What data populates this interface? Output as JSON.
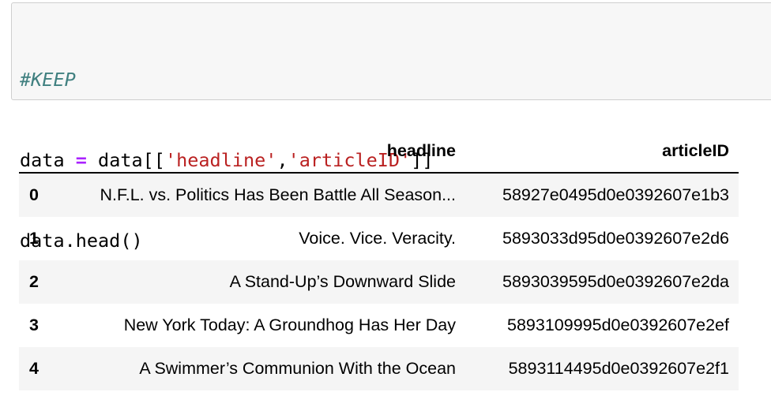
{
  "code_cell": {
    "comment": "#KEEP",
    "line2": {
      "var": "data ",
      "op": "=",
      "mid": " data[[",
      "str1": "'headline'",
      "comma": ",",
      "str2": "'articleID'",
      "end": "]]"
    },
    "line3": "data.head()"
  },
  "dataframe": {
    "columns": [
      "",
      "headline",
      "articleID"
    ],
    "rows": [
      {
        "index": "0",
        "headline": "N.F.L. vs. Politics Has Been Battle All Season...",
        "articleID": "58927e0495d0e0392607e1b3"
      },
      {
        "index": "1",
        "headline": "Voice. Vice. Veracity.",
        "articleID": "5893033d95d0e0392607e2d6"
      },
      {
        "index": "2",
        "headline": "A Stand-Up’s Downward Slide",
        "articleID": "5893039595d0e0392607e2da"
      },
      {
        "index": "3",
        "headline": "New York Today: A Groundhog Has Her Day",
        "articleID": "5893109995d0e0392607e2ef"
      },
      {
        "index": "4",
        "headline": "A Swimmer’s Communion With the Ocean",
        "articleID": "5893114495d0e0392607e2f1"
      }
    ]
  },
  "colors": {
    "comment": "#408080",
    "operator": "#aa22ff",
    "string": "#ba2121",
    "cell_background": "#f7f7f7",
    "row_stripe": "#f5f5f5"
  }
}
